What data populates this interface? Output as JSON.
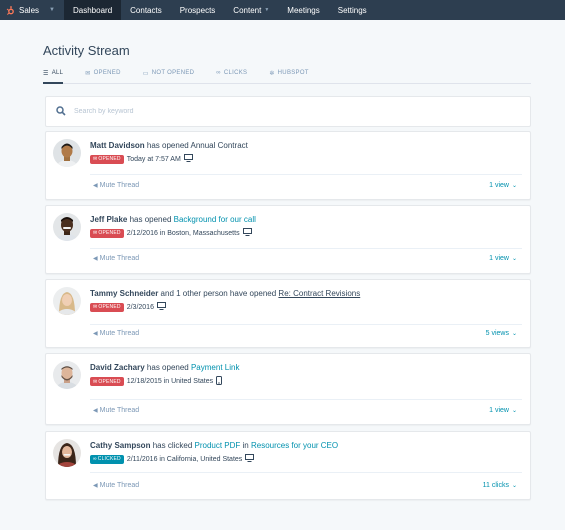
{
  "nav": {
    "brand": "Sales",
    "items": [
      {
        "label": "Dashboard",
        "active": true,
        "has_caret": false
      },
      {
        "label": "Contacts",
        "active": false,
        "has_caret": false
      },
      {
        "label": "Prospects",
        "active": false,
        "has_caret": false
      },
      {
        "label": "Content",
        "active": false,
        "has_caret": true
      },
      {
        "label": "Meetings",
        "active": false,
        "has_caret": false
      },
      {
        "label": "Settings",
        "active": false,
        "has_caret": false
      }
    ],
    "colors": {
      "bar": "#2d3e50",
      "active": "#1c2733",
      "brand_accent": "#ff7a59"
    }
  },
  "page": {
    "title": "Activity Stream"
  },
  "tabs": [
    {
      "label": "ALL",
      "icon": "list-icon",
      "active": true
    },
    {
      "label": "OPENED",
      "icon": "envelope-icon",
      "active": false
    },
    {
      "label": "NOT OPENED",
      "icon": "envelope-closed-icon",
      "active": false
    },
    {
      "label": "CLICKS",
      "icon": "link-icon",
      "active": false
    },
    {
      "label": "HUBSPOT",
      "icon": "sprocket-icon",
      "active": false
    }
  ],
  "search": {
    "placeholder": "Search by keyword"
  },
  "activities": [
    {
      "name": "Matt Davidson",
      "action": " has opened ",
      "target": "Annual Contract",
      "target_style": "plain",
      "badge": "OPENED",
      "meta": "Today at 7:57 AM",
      "device": "desktop-icon",
      "mute": "Mute Thread",
      "views": "1 view"
    },
    {
      "name": "Jeff Plake",
      "action": " has opened ",
      "target": "Background for our call",
      "target_style": "link",
      "badge": "OPENED",
      "meta": "2/12/2016 in Boston, Massachusetts",
      "device": "desktop-icon",
      "mute": "Mute Thread",
      "views": "1 view"
    },
    {
      "name": "Tammy Schneider",
      "action": " and 1 other person have opened ",
      "target": "Re: Contract Revisions",
      "target_style": "underline",
      "badge": "OPENED",
      "meta": "2/3/2016",
      "device": "desktop-icon",
      "mute": "Mute Thread",
      "views": "5 views"
    },
    {
      "name": "David Zachary",
      "action": " has opened ",
      "target": "Payment Link",
      "target_style": "link",
      "badge": "OPENED",
      "meta": "12/18/2015 in United States",
      "device": "mobile-icon",
      "mute": "Mute Thread",
      "views": "1 view"
    },
    {
      "name": "Cathy Sampson",
      "action": " has clicked ",
      "target": "Product PDF",
      "target_style": "link",
      "action2": " in ",
      "target2": "Resources for your CEO",
      "badge": "CLICKED",
      "meta": "2/11/2016 in California, United States",
      "device": "desktop-icon",
      "mute": "Mute Thread",
      "views": "11 clicks"
    }
  ],
  "colors": {
    "opened_badge": "#d94c53",
    "clicked_badge": "#0091ae",
    "link": "#0091ae"
  }
}
